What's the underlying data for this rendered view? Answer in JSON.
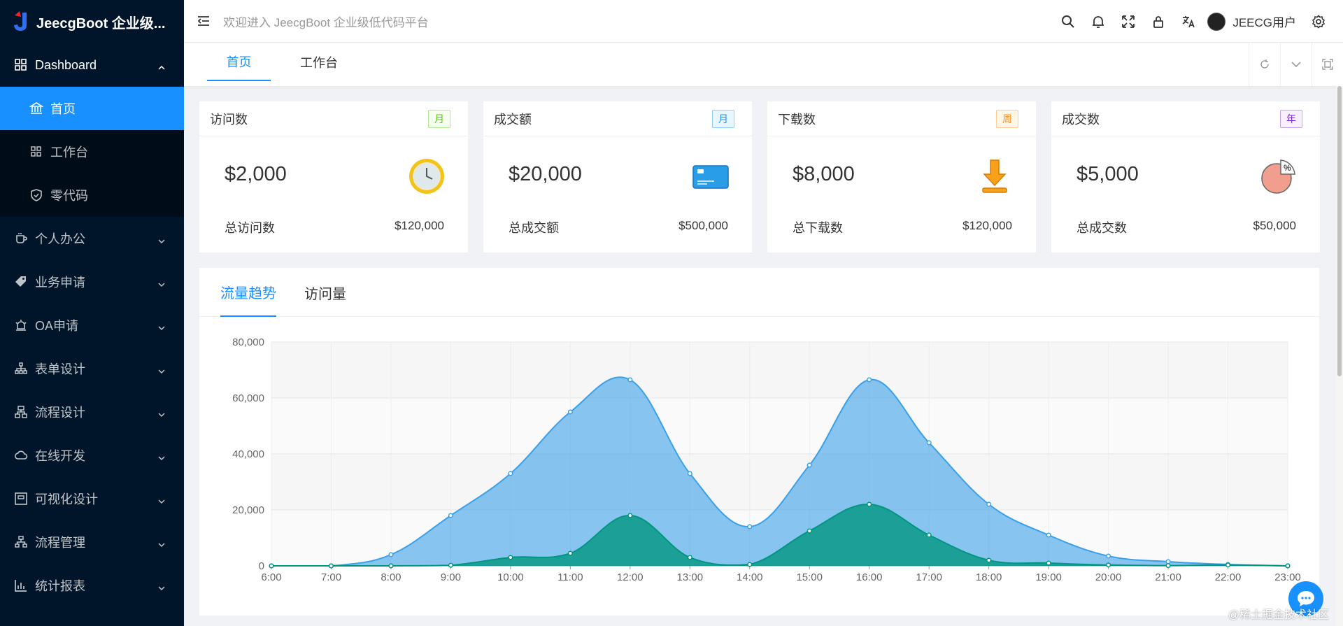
{
  "app": {
    "title": "JeecgBoot 企业级...",
    "welcome": "欢迎进入 JeecgBoot 企业级低代码平台",
    "username": "JEECG用户"
  },
  "sidebar": {
    "items": [
      {
        "label": "Dashboard",
        "icon": "dashboard-icon",
        "expanded": true
      },
      {
        "label": "首页",
        "icon": "bank-icon",
        "active": true,
        "sub": true
      },
      {
        "label": "工作台",
        "icon": "appstore-icon",
        "sub": true
      },
      {
        "label": "零代码",
        "icon": "shield-icon",
        "sub": true
      },
      {
        "label": "个人办公",
        "icon": "coffee-icon"
      },
      {
        "label": "业务申请",
        "icon": "tag-icon"
      },
      {
        "label": "OA申请",
        "icon": "alert-icon"
      },
      {
        "label": "表单设计",
        "icon": "cluster-icon"
      },
      {
        "label": "流程设计",
        "icon": "apartment-icon"
      },
      {
        "label": "在线开发",
        "icon": "cloud-icon"
      },
      {
        "label": "可视化设计",
        "icon": "layout-icon"
      },
      {
        "label": "流程管理",
        "icon": "partition-icon"
      },
      {
        "label": "统计报表",
        "icon": "bar-chart-icon"
      }
    ]
  },
  "tabs": [
    {
      "label": "首页",
      "active": true
    },
    {
      "label": "工作台"
    }
  ],
  "cards": [
    {
      "title": "访问数",
      "badge": "月",
      "badge_color": "#52c41a",
      "badge_bg": "#f6ffed",
      "value": "$2,000",
      "foot_label": "总访问数",
      "foot_value": "$120,000",
      "icon": "clock-icon"
    },
    {
      "title": "成交额",
      "badge": "月",
      "badge_color": "#1890ff",
      "badge_bg": "#e6f7ff",
      "value": "$20,000",
      "foot_label": "总成交额",
      "foot_value": "$500,000",
      "icon": "credit-card-icon"
    },
    {
      "title": "下载数",
      "badge": "周",
      "badge_color": "#fa8c16",
      "badge_bg": "#fff7e6",
      "value": "$8,000",
      "foot_label": "总下载数",
      "foot_value": "$120,000",
      "icon": "download-icon"
    },
    {
      "title": "成交数",
      "badge": "年",
      "badge_color": "#722ed1",
      "badge_bg": "#f9f0ff",
      "value": "$5,000",
      "foot_label": "总成交数",
      "foot_value": "$50,000",
      "icon": "pie-chart-icon"
    }
  ],
  "panel_tabs": [
    {
      "label": "流量趋势",
      "active": true
    },
    {
      "label": "访问量"
    }
  ],
  "watermark": "@稀土掘金技术社区",
  "chart_data": {
    "type": "area",
    "x": [
      "6:00",
      "7:00",
      "8:00",
      "9:00",
      "10:00",
      "11:00",
      "12:00",
      "13:00",
      "14:00",
      "15:00",
      "16:00",
      "17:00",
      "18:00",
      "19:00",
      "20:00",
      "21:00",
      "22:00",
      "23:00"
    ],
    "ylim": [
      0,
      80000
    ],
    "yticks": [
      "0",
      "20,000",
      "40,000",
      "60,000",
      "80,000"
    ],
    "grid": true,
    "series": [
      {
        "values": [
          0,
          0,
          4000,
          18000,
          33000,
          55000,
          66500,
          33000,
          14000,
          36000,
          66500,
          44000,
          22000,
          11000,
          3500,
          1500,
          500,
          0
        ],
        "color": "#3aa0e9"
      },
      {
        "values": [
          0,
          0,
          0,
          200,
          3000,
          4500,
          18000,
          3000,
          500,
          12500,
          22000,
          11000,
          2000,
          1000,
          300,
          100,
          300,
          0
        ],
        "color": "#019680"
      }
    ]
  }
}
